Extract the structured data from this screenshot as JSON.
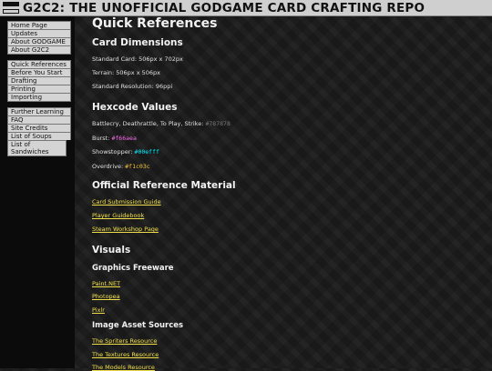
{
  "header": {
    "title": "G2C2: THE UNOFFICIAL GODGAME CARD CRAFTING REPO"
  },
  "sidebar": {
    "groups": [
      [
        {
          "label": "Home Page"
        },
        {
          "label": "Updates"
        },
        {
          "label": "About GODGAME"
        },
        {
          "label": "About G2C2"
        }
      ],
      [
        {
          "label": "Quick References"
        },
        {
          "label": "Before You Start"
        },
        {
          "label": "Drafting"
        },
        {
          "label": "Printing"
        },
        {
          "label": "Importing"
        }
      ],
      [
        {
          "label": "Further Learning"
        },
        {
          "label": "FAQ"
        },
        {
          "label": "Site Credits"
        },
        {
          "label": "List of Soups"
        },
        {
          "label": "List of Sandwiches"
        }
      ]
    ]
  },
  "content": {
    "page_title": "Quick References",
    "card_dimensions": {
      "heading": "Card Dimensions",
      "lines": [
        "Standard Card: 506px x 702px",
        "Terrain: 506px x 506px",
        "Standard Resolution: 96ppi"
      ]
    },
    "hexcode_values": {
      "heading": "Hexcode Values",
      "items": [
        {
          "label": "Battlecry, Deathrattle, To Play, Strike:",
          "code": "#787878",
          "color": "#787878"
        },
        {
          "label": "Burst:",
          "code": "#f66aea",
          "color": "#f66aea"
        },
        {
          "label": "Showstopper:",
          "code": "#00efff",
          "color": "#00efff"
        },
        {
          "label": "Overdrive:",
          "code": "#f1c03c",
          "color": "#f1c03c"
        }
      ]
    },
    "official_reference": {
      "heading": "Official Reference Material",
      "links": [
        "Card Submission Guide",
        "Player Guidebook",
        "Steam Workshop Page"
      ]
    },
    "visuals": {
      "heading": "Visuals",
      "graphics_freeware": {
        "heading": "Graphics Freeware",
        "links": [
          "Paint.NET",
          "Photopea",
          "Pixlr"
        ]
      },
      "image_asset_sources": {
        "heading": "Image Asset Sources",
        "links": [
          "The Spriters Resource",
          "The Textures Resource",
          "The Models Resource"
        ]
      }
    }
  },
  "colors": {
    "link": "#f2e04a",
    "header_bg": "#cfcfcf",
    "sidebar_bg": "#0b0b0b"
  }
}
